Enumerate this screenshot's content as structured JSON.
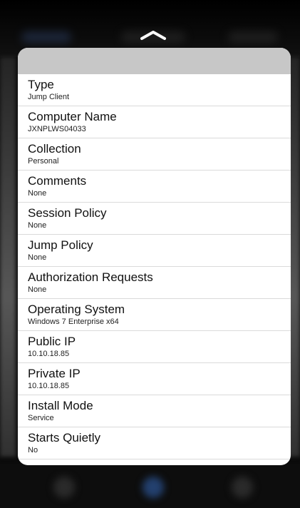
{
  "details": [
    {
      "label": "Type",
      "value": "Jump Client"
    },
    {
      "label": "Computer Name",
      "value": "JXNPLWS04033"
    },
    {
      "label": "Collection",
      "value": "Personal"
    },
    {
      "label": "Comments",
      "value": "None"
    },
    {
      "label": "Session Policy",
      "value": "None"
    },
    {
      "label": "Jump Policy",
      "value": "None"
    },
    {
      "label": "Authorization Requests",
      "value": "None"
    },
    {
      "label": "Operating System",
      "value": "Windows 7 Enterprise x64"
    },
    {
      "label": "Public IP",
      "value": "10.10.18.85"
    },
    {
      "label": "Private IP",
      "value": "10.10.18.85"
    },
    {
      "label": "Install Mode",
      "value": "Service"
    },
    {
      "label": "Starts Quietly",
      "value": "No"
    }
  ],
  "colors": {
    "background": "#0b0b0b",
    "card": "#ffffff",
    "card_header": "#c7c7c7",
    "separator": "#dadada"
  },
  "icons": {
    "handle": "chevron-up-icon"
  }
}
